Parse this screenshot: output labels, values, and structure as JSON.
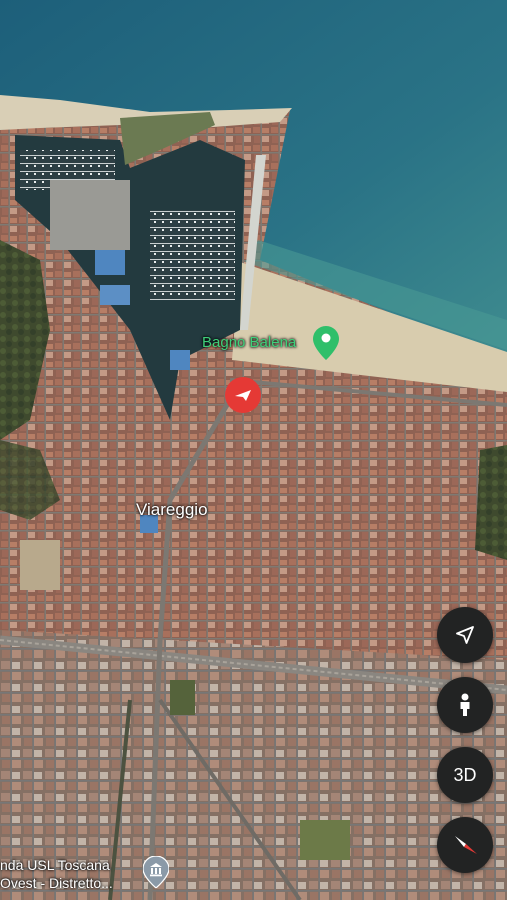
{
  "map": {
    "water_color": "#2a6f86",
    "beach_color": "#d9cdb0",
    "city_color": "#9a6b5a",
    "vegetation_color": "#3c4a2c"
  },
  "poi": {
    "name": "Bagno Balena",
    "pin_color": "#2fbf6a"
  },
  "city_label": "Viareggio",
  "bottom_place": {
    "line1": "nda USL Toscana",
    "line2": "Ovest - Distretto..."
  },
  "current_location": {
    "color": "#e53935"
  },
  "controls": {
    "navigate_icon": "navigation-arrow-icon",
    "street_view_icon": "pegman-icon",
    "three_d_label": "3D",
    "compass_icon": "compass-icon"
  }
}
